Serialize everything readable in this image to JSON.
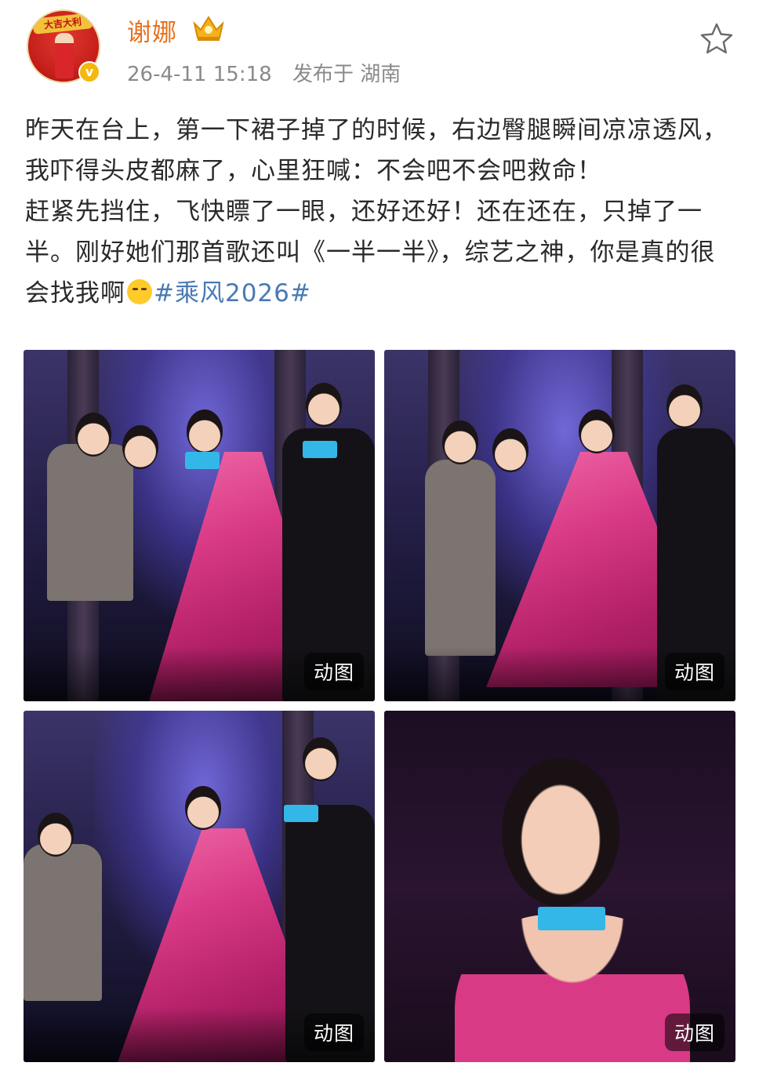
{
  "author": {
    "name": "谢娜",
    "avatar_banner": "大吉大利",
    "verified_badge": "v",
    "level_icon": "crown-icon"
  },
  "meta": {
    "timestamp": "26-4-11 15:18",
    "location": "发布于 湖南"
  },
  "actions": {
    "favorite_icon": "star-icon"
  },
  "post": {
    "line1": "昨天在台上，第一下裙子掉了的时候，右边臀腿瞬间凉凉透风，我吓得头皮都麻了，心里狂喊：不会吧不会吧救命！",
    "line2": "赶紧先挡住，飞快瞟了一眼，还好还好！还在还在，只掉了一半。刚好她们那首歌还叫《一半一半》，综艺之神，你是真的很会找我啊",
    "emoji": "laugh-cry-emoji",
    "hashtag": "#乘风2026#"
  },
  "images": [
    {
      "badge": "动图"
    },
    {
      "badge": "动图"
    },
    {
      "badge": "动图"
    },
    {
      "badge": "动图"
    }
  ],
  "colors": {
    "username": "#e8701d",
    "meta": "#8a8a8a",
    "hashtag": "#4a7ab5",
    "dress": "#d93a86"
  }
}
